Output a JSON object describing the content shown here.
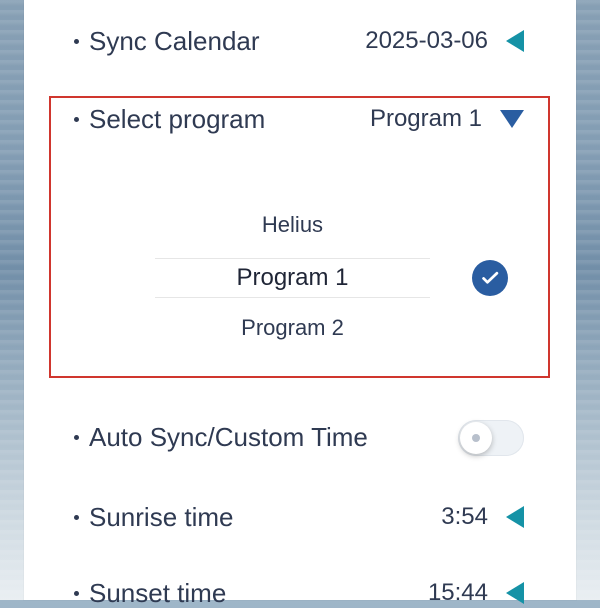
{
  "rows": {
    "sync_calendar": {
      "label": "Sync Calendar",
      "value": "2025-03-06"
    },
    "select_program": {
      "label": "Select program",
      "value": "Program 1"
    },
    "auto_sync": {
      "label": "Auto Sync/Custom Time",
      "enabled": false
    },
    "sunrise": {
      "label": "Sunrise time",
      "value": "3:54"
    },
    "sunset": {
      "label": "Sunset time",
      "value": "15:44"
    }
  },
  "picker": {
    "options": [
      "Helius",
      "Program 1",
      "Program 2"
    ],
    "selected": "Program 1"
  },
  "colors": {
    "text": "#2f3a52",
    "accent_teal": "#1592a6",
    "accent_blue": "#2a5da1",
    "highlight_border": "#d0362e"
  },
  "icons": {
    "collapse": "triangle-left-icon",
    "expand": "triangle-down-icon",
    "selected": "check-circle-icon"
  }
}
